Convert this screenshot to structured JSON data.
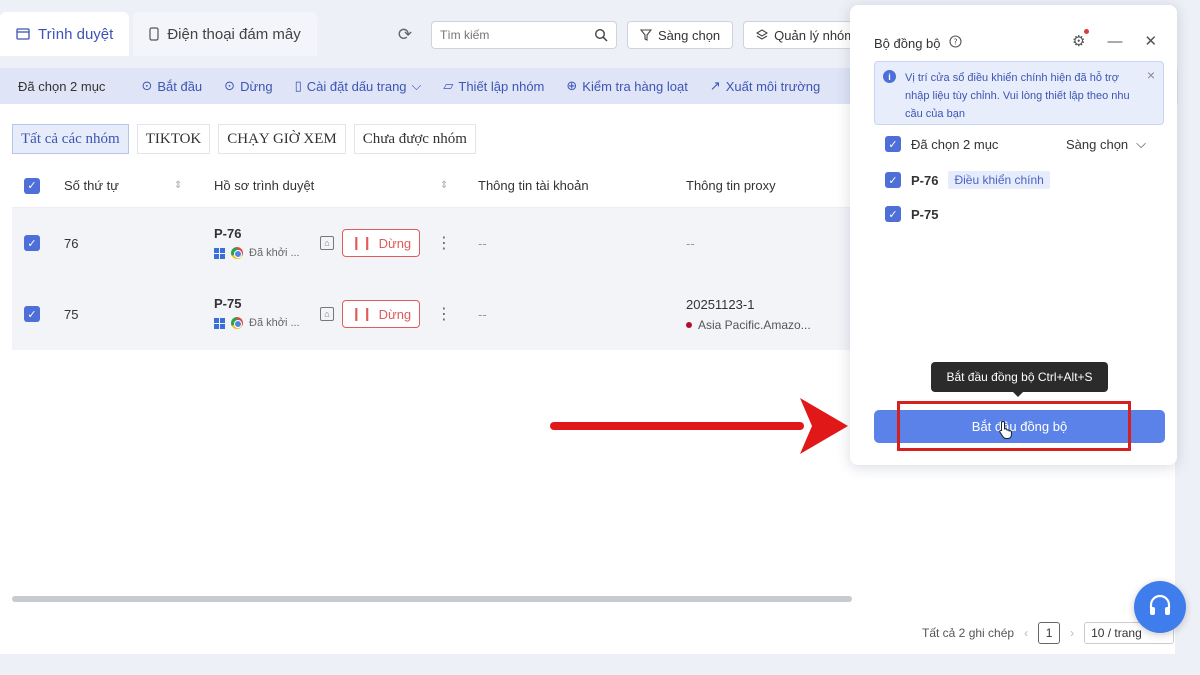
{
  "tabs": [
    {
      "label": "Trình duyệt",
      "icon": "browser-icon",
      "active": true
    },
    {
      "label": "Điện thoại đám mây",
      "icon": "phone-icon",
      "active": false
    }
  ],
  "toolbar": {
    "search_placeholder": "Tìm kiếm",
    "filter_label": "Sàng chọn",
    "group_manage_label": "Quản lý nhóm"
  },
  "actionbar": {
    "selected": "Đã chọn 2 mục",
    "start": "Bắt đầu",
    "stop": "Dừng",
    "bookmark": "Cài đặt dấu trang",
    "setup_group": "Thiết lập nhóm",
    "batch_check": "Kiểm tra hàng loạt",
    "export_env": "Xuất môi trường"
  },
  "groups": [
    "Tất cả các nhóm",
    "TIKTOK",
    "CHẠY GIỜ XEM",
    "Chưa được nhóm"
  ],
  "columns": {
    "number": "Số thứ tự",
    "profile": "Hồ sơ trình duyệt",
    "account": "Thông tin tài khoản",
    "proxy": "Thông tin proxy"
  },
  "rows": [
    {
      "no": "76",
      "name": "P-76",
      "status": "Đã khởi ...",
      "stop": "Dừng",
      "account": "--",
      "proxy": "--",
      "proxy_region": ""
    },
    {
      "no": "75",
      "name": "P-75",
      "status": "Đã khởi ...",
      "stop": "Dừng",
      "account": "--",
      "proxy": "20251123-1",
      "proxy_region": "Asia Pacific.Amazo..."
    }
  ],
  "footer": {
    "total": "Tất cả 2 ghi chép",
    "page": "1",
    "per_page": "10 / trang"
  },
  "sync_panel": {
    "title": "Bộ đồng bộ",
    "notice": "Vị trí cửa sổ điều khiển chính hiện đã hỗ trợ nhập liệu tùy chỉnh. Vui lòng thiết lập theo nhu cầu của bạn",
    "selected": "Đã chọn 2 mục",
    "filter": "Sàng chọn",
    "items": [
      {
        "name": "P-76",
        "tag": "Điều khiển chính"
      },
      {
        "name": "P-75",
        "tag": ""
      }
    ],
    "tooltip": "Bắt đầu đồng bộ Ctrl+Alt+S",
    "start_button": "Bắt đầu đồng bộ"
  },
  "colors": {
    "accent": "#4e6ed8",
    "button": "#5b82e8",
    "stop": "#e05b5b",
    "highlight": "#d62020"
  }
}
